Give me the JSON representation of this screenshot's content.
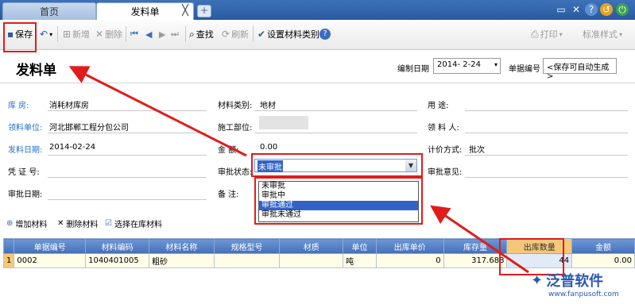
{
  "tabs": {
    "home": "首页",
    "issue": "发料单",
    "close": "╳",
    "add": "+"
  },
  "toolbar": {
    "save": "保存",
    "add": "新增",
    "delete": "删除",
    "find": "查找",
    "refresh": "刷新",
    "set_category": "设置材料类别",
    "print": "打印",
    "style": "标准样式"
  },
  "page": {
    "title": "发料单"
  },
  "header": {
    "date_label": "编制日期",
    "date_value": "2014- 2-24",
    "docno_label": "单据编号",
    "docno_value": "<保存可自动生成>"
  },
  "form": {
    "warehouse_label": "库    房:",
    "warehouse_value": "消耗材库房",
    "dept_label": "领料单位:",
    "dept_value": "河北邯郸工程分包公司",
    "date_label": "发料日期:",
    "date_value": "2014-02-24",
    "voucher_label": "凭 证 号:",
    "approve_date_label": "审批日期:",
    "category_label": "材料类别:",
    "category_value": "地材",
    "construct_label": "施工部位:",
    "amount_label": "金    额:",
    "amount_value": "0.00",
    "status_label": "审批状态:",
    "status_value": "未审批",
    "remark_label": "备    注:",
    "purpose_label": "用    途:",
    "receiver_label": "领 料 人:",
    "pricing_label": "计价方式:",
    "pricing_value": "批次",
    "opinion_label": "审批意见:"
  },
  "status_options": [
    "未审批",
    "审批中",
    "审批通过",
    "审批未通过"
  ],
  "grid_toolbar": {
    "add": "增加材料",
    "remove": "删除材料",
    "select": "选择在库材料"
  },
  "table": {
    "headers": [
      "单据编号",
      "材料编码",
      "材料名称",
      "规格型号",
      "材质",
      "单位",
      "出库单价",
      "库存量",
      "出库数量",
      "金额"
    ],
    "rows": [
      {
        "idx": "1",
        "cells": [
          "0002",
          "1040401005",
          "粗砂",
          "",
          "",
          "吨",
          "0",
          "317.688",
          "44",
          "0.00"
        ]
      }
    ]
  },
  "watermark": {
    "brand": "泛普软件",
    "url": "www.fanpusoft.com"
  },
  "colors": {
    "accent": "#2a5aa0",
    "highlight": "#e01c1c",
    "header_blue": "#4470b8"
  }
}
